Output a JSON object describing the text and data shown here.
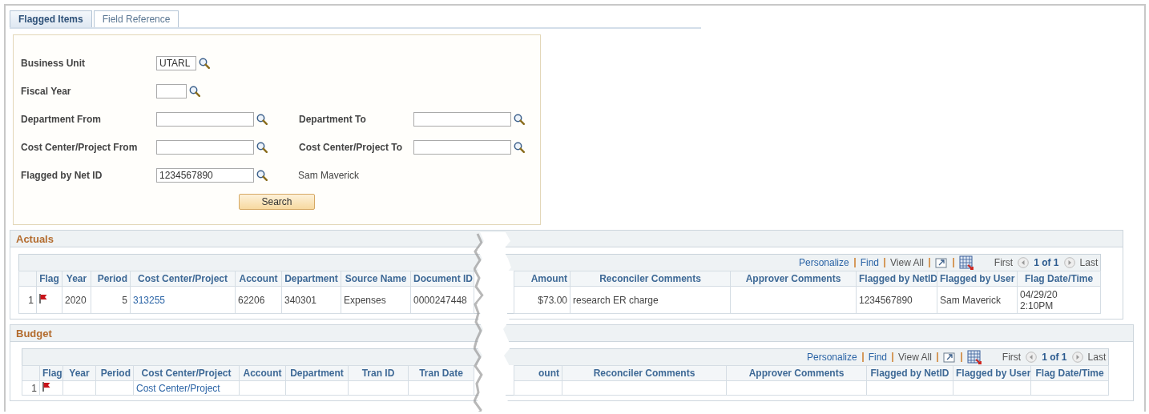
{
  "tabs": [
    {
      "label": "Flagged Items",
      "selected": true
    },
    {
      "label": "Field Reference",
      "selected": false
    }
  ],
  "search_form": {
    "rows": [
      {
        "fields": [
          {
            "label": "Business Unit",
            "value": "UTARL",
            "kind": "short"
          }
        ]
      },
      {
        "fields": [
          {
            "label": "Fiscal Year",
            "kind": "tiny"
          }
        ]
      },
      {
        "fields": [
          {
            "label": "Department From",
            "kind": "long"
          },
          {
            "label": "Department To",
            "kind": "long"
          }
        ]
      },
      {
        "fields": [
          {
            "label": "Cost Center/Project From",
            "kind": "long"
          },
          {
            "label": "Cost Center/Project To",
            "kind": "long"
          }
        ]
      },
      {
        "fields": [
          {
            "label": "Flagged by Net ID",
            "value": "1234567890",
            "kind": "long",
            "description": "Sam Maverick"
          }
        ]
      }
    ],
    "button": "Search"
  },
  "sections": [
    {
      "title": "Actuals",
      "toolbar": {
        "personalize": "Personalize",
        "find": "Find",
        "view_all": "View All",
        "first": "First",
        "count": "1 of 1",
        "last": "Last"
      },
      "columns": [
        "Flag",
        "Year",
        "Period",
        "Cost Center/Project",
        "Account",
        "Department",
        "Source Name",
        "Document ID",
        "Amount",
        "Reconciler Comments",
        "Approver Comments",
        "Flagged by NetID",
        "Flagged by User",
        "Flag Date/Time"
      ],
      "rows": [
        {
          "row_number": "1",
          "flagged": true,
          "cells": [
            "",
            "2020",
            "5",
            "313255",
            "62206",
            "340301",
            "Expenses",
            "0000247448",
            "$73.00",
            "research ER charge",
            "",
            "1234567890",
            "Sam Maverick",
            "04/29/20\n2:10PM"
          ]
        }
      ]
    },
    {
      "title": "Budget",
      "toolbar": {
        "personalize": "Personalize",
        "find": "Find",
        "view_all": "View All",
        "first": "First",
        "count": "1 of 1",
        "last": "Last"
      },
      "columns": [
        "Flag",
        "Year",
        "Period",
        "Cost Center/Project",
        "Account",
        "Department",
        "Tran ID",
        "Tran Date",
        "ount",
        "Reconciler Comments",
        "Approver Comments",
        "Flagged by NetID",
        "Flagged by User",
        "Flag Date/Time"
      ],
      "rows": [
        {
          "row_number": "1",
          "flagged": true,
          "cells": [
            "",
            "",
            "",
            "Cost Center/Project",
            "",
            "",
            "",
            "",
            "",
            "",
            "",
            "",
            "",
            ""
          ]
        }
      ]
    }
  ]
}
